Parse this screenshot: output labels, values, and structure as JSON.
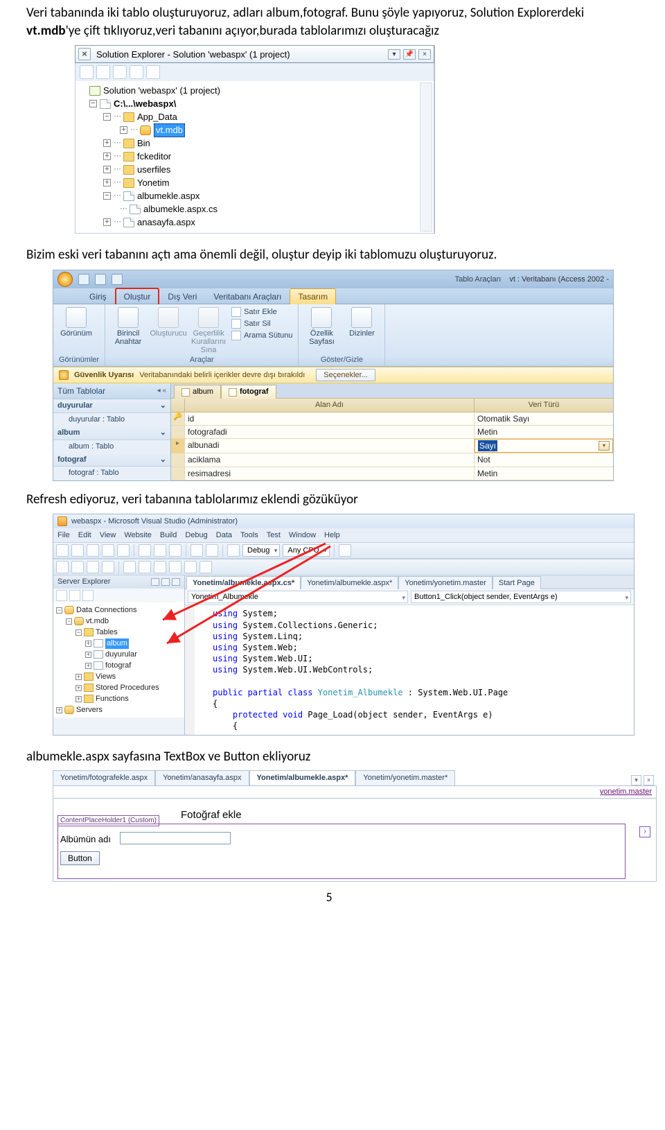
{
  "para1_plain": "Veri tabanında iki tablo oluşturuyoruz, adları album,fotograf. Bunu şöyle yapıyoruz, Solution Explorerdeki ",
  "para1_bold": "vt.mdb",
  "para1_rest": "'ye çift tıklıyoruz,veri tabanını açıyor,burada tablolarımızı oluşturacağız",
  "para2": "Bizim eski veri tabanını açtı ama önemli değil, oluştur deyip iki tablomuzu oluşturuyoruz.",
  "para3": "Refresh ediyoruz, veri tabanına tablolarımız eklendi gözüküyor",
  "para4": "albumekle.aspx sayfasına TextBox ve Button ekliyoruz",
  "page_number": "5",
  "solexp": {
    "title": "Solution Explorer - Solution 'webaspx' (1 project)",
    "solution": "Solution 'webaspx' (1 project)",
    "proj": "C:\\...\\webaspx\\",
    "nodes": {
      "app_data": "App_Data",
      "vtmdb": "vt.mdb",
      "bin": "Bin",
      "fckeditor": "fckeditor",
      "userfiles": "userfiles",
      "yonetim": "Yonetim",
      "albumekle": "albumekle.aspx",
      "albumekle_cs": "albumekle.aspx.cs",
      "anasayfa": "anasayfa.aspx"
    }
  },
  "access": {
    "context_title": "Tablo Araçları",
    "db_title": "vt : Veritabanı (Access 2002 -",
    "tabs": {
      "giris": "Giriş",
      "olustur": "Oluştur",
      "disveri": "Dış Veri",
      "vtaraclari": "Veritabanı Araçları",
      "tasarim": "Tasarım"
    },
    "groups": {
      "gorunumler": {
        "gorunum": "Görünüm",
        "title": "Görünümler"
      },
      "araclar": {
        "birincil": "Birincil Anahtar",
        "olusturucu": "Oluşturucu",
        "gecerlilik": "Geçerlilik Kurallarını Sına",
        "satirekle": "Satır Ekle",
        "satirsil": "Satır Sil",
        "arama": "Arama Sütunu",
        "title": "Araçlar"
      },
      "goster": {
        "ozellik": "Özellik Sayfası",
        "dizinler": "Dizinler",
        "title": "Göster/Gizle"
      }
    },
    "warn": {
      "label": "Güvenlik Uyarısı",
      "text": "Veritabanındaki belirli içerikler devre dışı bırakıldı",
      "options": "Seçenekler..."
    },
    "nav": {
      "header": "Tüm Tablolar",
      "g_duyurular": "duyurular",
      "i_duyurular": "duyurular : Tablo",
      "g_album": "album",
      "i_album": "album : Tablo",
      "g_fotograf": "fotograf",
      "i_fotograf": "fotograf : Tablo"
    },
    "worktabs": {
      "album": "album",
      "fotograf": "fotograf"
    },
    "gridheaders": {
      "field": "Alan Adı",
      "type": "Veri Türü"
    },
    "rows": [
      {
        "field": "id",
        "type": "Otomatik Sayı",
        "pk": true
      },
      {
        "field": "fotografadi",
        "type": "Metin"
      },
      {
        "field": "albunadi",
        "type": "Sayı",
        "sel": true
      },
      {
        "field": "aciklama",
        "type": "Not"
      },
      {
        "field": "resimadresi",
        "type": "Metin"
      }
    ]
  },
  "vs": {
    "title": "webaspx - Microsoft Visual Studio (Administrator)",
    "menu": [
      "File",
      "Edit",
      "View",
      "Website",
      "Build",
      "Debug",
      "Data",
      "Tools",
      "Test",
      "Window",
      "Help"
    ],
    "tool_debug": "Debug",
    "tool_cpu": "Any CPU",
    "se_title": "Server Explorer",
    "se_nodes": {
      "dc": "Data Connections",
      "vt": "vt.mdb",
      "tables": "Tables",
      "album": "album",
      "duyurular": "duyurular",
      "fotograf": "fotograf",
      "views": "Views",
      "sp": "Stored Procedures",
      "fn": "Functions",
      "servers": "Servers"
    },
    "etabs": [
      "Yonetim/albumekle.aspx.cs*",
      "Yonetim/albumekle.aspx*",
      "Yonetim/yonetim.master",
      "Start Page"
    ],
    "crumb_left": "Yonetim_Albumekle",
    "crumb_right": "Button1_Click(object sender, EventArgs e)",
    "code": [
      {
        "t": "using ",
        "k": true,
        "r": "System;"
      },
      {
        "t": "using ",
        "k": true,
        "r": "System.Collections.Generic;"
      },
      {
        "t": "using ",
        "k": true,
        "r": "System.Linq;"
      },
      {
        "t": "using ",
        "k": true,
        "r": "System.Web;"
      },
      {
        "t": "using ",
        "k": true,
        "r": "System.Web.UI;"
      },
      {
        "t": "using ",
        "k": true,
        "r": "System.Web.UI.WebControls;"
      }
    ],
    "code_class_kw": "public partial class ",
    "code_class_name": "Yonetim_Albumekle",
    "code_class_rest": " : System.Web.UI.Page",
    "code_brace": "{",
    "code_method_kw": "    protected void ",
    "code_method": "Page_Load(object sender, EventArgs e)",
    "code_brace2": "    {"
  },
  "dsg": {
    "tabs": [
      "Yonetim/fotografekle.aspx",
      "Yonetim/anasayfa.aspx",
      "Yonetim/albumekle.aspx*",
      "Yonetim/yonetim.master*"
    ],
    "masterpath": "yonetim.master",
    "heading": "Fotoğraf ekle",
    "placeholder_tag": "ContentPlaceHolder1 (Custom)",
    "field_label": "Albümün adı",
    "button": "Button"
  }
}
